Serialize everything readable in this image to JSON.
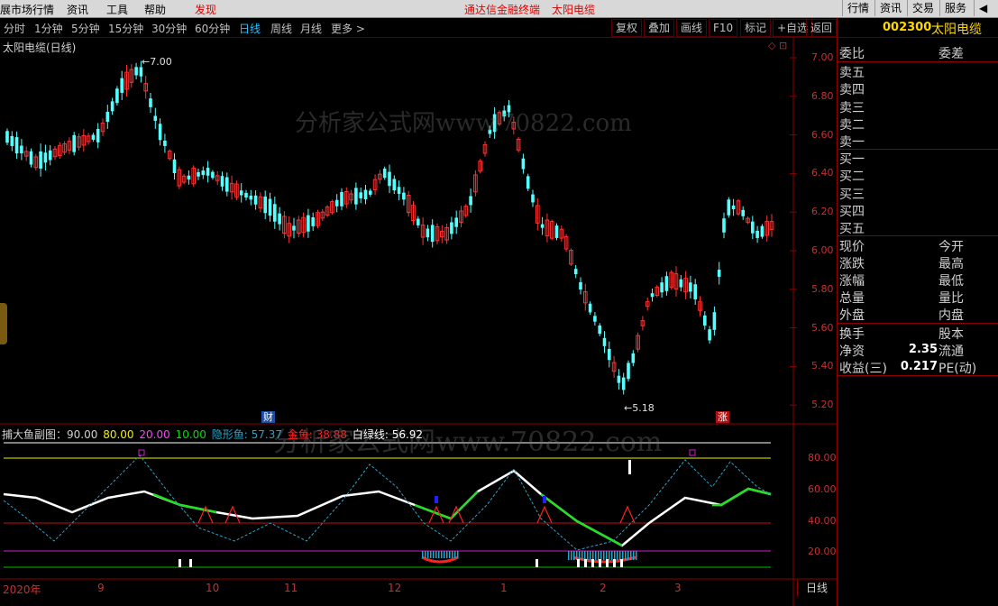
{
  "top_menu": {
    "items": [
      "展市场行情",
      "资讯",
      "工具",
      "帮助",
      "发现"
    ],
    "center_text_1": "通达信金融终端",
    "center_text_2": "太阳电缆",
    "right_buttons": [
      "行情",
      "资讯",
      "交易",
      "服务"
    ]
  },
  "period_bar": {
    "periods": [
      "分时",
      "1分钟",
      "5分钟",
      "15分钟",
      "30分钟",
      "60分钟",
      "日线",
      "周线",
      "月线",
      "更多 >"
    ],
    "selected": "日线",
    "tools": [
      "复权",
      "叠加",
      "画线",
      "F10",
      "标记",
      "+自选",
      "返回"
    ]
  },
  "stock": {
    "code": "002300",
    "name": "太阳电缆"
  },
  "main_chart": {
    "title": "太阳电缆(日线)",
    "price_axis": [
      "7.00",
      "6.80",
      "6.60",
      "6.40",
      "6.20",
      "6.00",
      "5.80",
      "5.60",
      "5.40",
      "5.20"
    ],
    "high_marker": "7.00",
    "low_marker": "5.18",
    "badge_cai": "财",
    "badge_zhang": "涨"
  },
  "sub_chart": {
    "name": "捕大鱼副图",
    "legend": [
      {
        "text": "捕大鱼副图：90.00",
        "color": "#d0d0d0"
      },
      {
        "text": "80.00",
        "color": "#f0f000"
      },
      {
        "text": "20.00",
        "color": "#ff40ff"
      },
      {
        "text": "10.00",
        "color": "#00e000"
      },
      {
        "text": "隐形鱼: 57.37",
        "color": "#2aa3c8"
      },
      {
        "text": "金鱼: 38.88",
        "color": "#ff2020"
      },
      {
        "text": "白绿线: 56.92",
        "color": "#ffffff"
      }
    ],
    "axis": [
      "80.00",
      "60.00",
      "40.00",
      "20.00"
    ]
  },
  "x_axis": [
    "2020年",
    "9",
    "10",
    "11",
    "12",
    "1",
    "2",
    "3"
  ],
  "bottom_button": "日线",
  "watermark": "分析家公式网www.70822.com",
  "right_panel": {
    "wei": {
      "left": "委比",
      "right": "委差"
    },
    "sell": [
      "卖五",
      "卖四",
      "卖三",
      "卖二",
      "卖一"
    ],
    "buy": [
      "买一",
      "买二",
      "买三",
      "买四",
      "买五"
    ],
    "quote_rows": [
      {
        "l": "现价",
        "v": "",
        "r": "今开"
      },
      {
        "l": "涨跌",
        "v": "",
        "r": "最高"
      },
      {
        "l": "涨幅",
        "v": "",
        "r": "最低"
      },
      {
        "l": "总量",
        "v": "",
        "r": "量比"
      },
      {
        "l": "外盘",
        "v": "",
        "r": "内盘"
      }
    ],
    "fin_rows": [
      {
        "l": "换手",
        "v": "",
        "r": "股本"
      },
      {
        "l": "净资",
        "v": "2.35",
        "r": "流通"
      },
      {
        "l": "收益(三)",
        "v": "0.217",
        "r": "PE(动)"
      }
    ]
  },
  "colors": {
    "up": "#ff3232",
    "down": "#54ffff",
    "grid": "#8b0000",
    "selected": "#22c0ff",
    "code": "#ffd700"
  }
}
